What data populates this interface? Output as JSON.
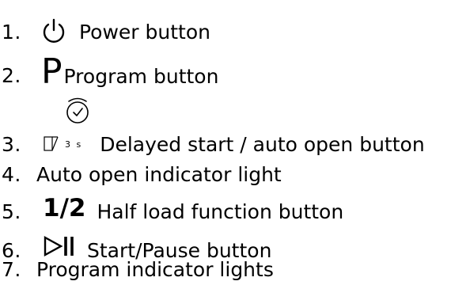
{
  "legend": {
    "items": [
      {
        "number": "1.",
        "icon": "power-icon",
        "label": "Power button"
      },
      {
        "number": "2.",
        "icon": "program-p-icon",
        "label": "Program button"
      },
      {
        "number": "3.",
        "icon": "delay-auto-open-icon",
        "icon_text": "3 s",
        "label": "Delayed start / auto open button"
      },
      {
        "number": "4.",
        "label": "Auto open indicator light"
      },
      {
        "number": "5.",
        "icon": "half-load-icon",
        "icon_text": "1/2",
        "label": "Half load function button"
      },
      {
        "number": "6.",
        "icon": "start-pause-icon",
        "label": "Start/Pause button"
      },
      {
        "number": "7.",
        "label": "Program indicator lights"
      }
    ]
  }
}
